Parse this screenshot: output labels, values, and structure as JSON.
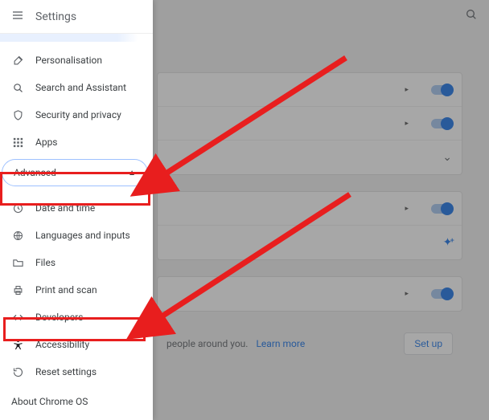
{
  "header": {
    "title": "Settings"
  },
  "sidebar": {
    "items": [
      {
        "label": "Personalisation"
      },
      {
        "label": "Search and Assistant"
      },
      {
        "label": "Security and privacy"
      },
      {
        "label": "Apps"
      }
    ],
    "advanced_label": "Advanced",
    "advanced_items": [
      {
        "label": "Date and time"
      },
      {
        "label": "Languages and inputs"
      },
      {
        "label": "Files"
      },
      {
        "label": "Print and scan"
      },
      {
        "label": "Developers"
      },
      {
        "label": "Accessibility"
      },
      {
        "label": "Reset settings"
      }
    ],
    "about_label": "About Chrome OS"
  },
  "main": {
    "hint_text": "people around you.",
    "learn_more": "Learn more",
    "setup_label": "Set up"
  },
  "annotations": {
    "box1": "Advanced section highlight",
    "box2": "Accessibility item highlight"
  }
}
